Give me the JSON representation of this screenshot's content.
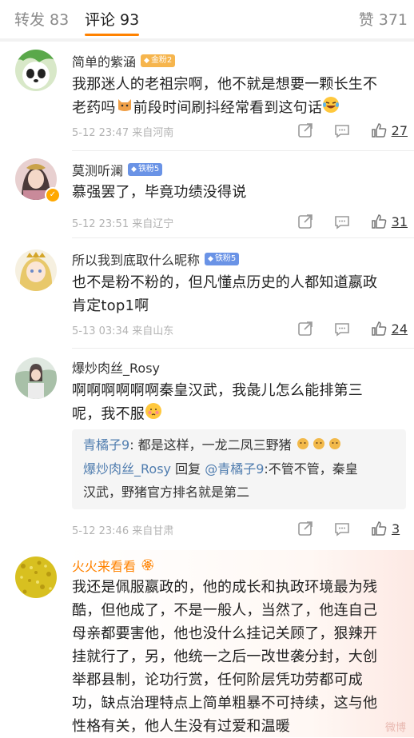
{
  "tabs": {
    "repost": "转发 83",
    "comment": "评论 93",
    "like": "赞 371"
  },
  "comments": [
    {
      "name": "简单的紫涵",
      "badge": "金粉2",
      "text_1": "我那迷人的老祖宗啊，他不就是想要一颗长生不",
      "text_2": "老药吗",
      "text_2b": "前段时间刷抖经常看到这句话",
      "meta": "5-12 23:47 来自河南",
      "likes": "27"
    },
    {
      "name": "莫测听澜",
      "badge": "铁粉5",
      "text_1": "慕强罢了，毕竟功绩没得说",
      "meta": "5-12 23:51 来自辽宁",
      "likes": "31"
    },
    {
      "name": "所以我到底取什么昵称",
      "badge": "铁粉5",
      "text_1": "也不是粉不粉的，但凡懂点历史的人都知道嬴政",
      "text_2": "肯定top1啊",
      "meta": "5-13 03:34 来自山东",
      "likes": "24"
    },
    {
      "name": "爆炒肉丝_Rosy",
      "text_1": "啊啊啊啊啊啊秦皇汉武，我彘儿怎么能排第三",
      "text_2": "呢，我不服",
      "reply_1_user": "青橘子9",
      "reply_1_text": ": 都是这样，一龙二凤三野猪",
      "reply_2_user": "爆炒肉丝_Rosy",
      "reply_2_mid": " 回复 ",
      "reply_2_target": "@青橘子9",
      "reply_2_text": ":不管不管，秦皇",
      "reply_2_line2": "汉武，野猪官方排名就是第二",
      "meta": "5-12 23:46 来自甘肃",
      "likes": "3"
    },
    {
      "name": "火火来看看",
      "lines": [
        "我还是佩服嬴政的，他的成长和执政环境最为残",
        "酷，但他成了，不是一般人，当然了，他连自己",
        "母亲都要害他，他也没什么挂记关顾了，狠辣开",
        "挂就行了，另，他统一之后一改世袭分封，大创",
        "举郡县制，论功行赏，任何阶层凭功劳都可成",
        "功，缺点治理特点上简单粗暴不可持续，这与他",
        "性格有关，他人生没有过爱和温暖"
      ]
    }
  ],
  "watermark": "微博",
  "icons": [
    "share-icon",
    "comment-icon",
    "like-icon",
    "v-badge-icon",
    "fan-badge-icon"
  ],
  "colors": {
    "accent": "#ff8200",
    "link": "#507daf",
    "iron_badge": "#6a93e6",
    "gold_badge": "#f6b54d"
  }
}
